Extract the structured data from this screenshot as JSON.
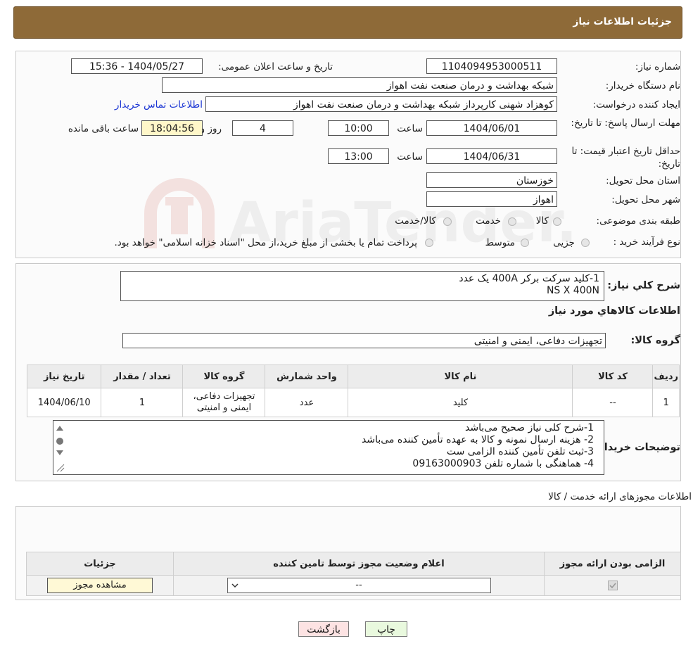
{
  "header": {
    "title": "جزئیات اطلاعات نیاز"
  },
  "form": {
    "need_number_label": "شماره نیاز:",
    "need_number": "1104094953000511",
    "announce_label": "تاریخ و ساعت اعلان عمومی:",
    "announce_value": "1404/05/27 - 15:36",
    "buyer_org_label": "نام دستگاه خریدار:",
    "buyer_org": "شبکه بهداشت و درمان صنعت نفت اهواز",
    "requester_label": "ایجاد کننده درخواست:",
    "requester": "کوهزاد شهنی کارپرداز شبکه بهداشت و درمان صنعت نفت اهواز",
    "contact_link": "اطلاعات تماس خریدار",
    "deadline_label": "مهلت ارسال پاسخ: تا تاریخ:",
    "deadline_date": "1404/06/01",
    "time_label": "ساعت",
    "deadline_time": "10:00",
    "days_value": "4",
    "days_label": "روز و",
    "remaining_time": "18:04:56",
    "remaining_label": "ساعت باقی مانده",
    "price_validity_label": "حداقل تاریخ اعتبار قیمت: تا تاریخ:",
    "price_validity_date": "1404/06/31",
    "price_validity_time": "13:00",
    "province_label": "استان محل تحویل:",
    "province": "خوزستان",
    "city_label": "شهر محل تحویل:",
    "city": "اهواز",
    "category_label": "طبقه بندی موضوعی:",
    "category_options": [
      "کالا",
      "خدمت",
      "کالا/خدمت"
    ],
    "process_label": "نوع فرآیند خرید :",
    "process_options": [
      "جزیی",
      "متوسط"
    ],
    "process_note": "پرداخت تمام یا بخشی از مبلغ خرید،از محل \"اسناد خزانه اسلامی\" خواهد بود."
  },
  "description": {
    "label": "شرح کلي نياز:",
    "lines": [
      "1-کلید سرکت برکر 400A یک عدد",
      "NS X 400N"
    ]
  },
  "goods": {
    "section_title": "اطلاعات کالاهاي مورد نياز",
    "group_label": "گروه کالا:",
    "group_value": "تجهیزات دفاعی، ایمنی و امنیتی",
    "columns": [
      "رديف",
      "کد کالا",
      "نام کالا",
      "واحد شمارش",
      "گروه کالا",
      "تعداد / مقدار",
      "تاریخ نیاز"
    ],
    "rows": [
      {
        "row": "1",
        "code": "--",
        "name": "کلید",
        "unit": "عدد",
        "group": "تجهیزات دفاعی، ایمنی و امنیتی",
        "qty": "1",
        "date": "1404/06/10"
      }
    ]
  },
  "buyer_notes": {
    "label": "توضیحات خریدار:",
    "lines": [
      "1-شرح کلی نیاز صحیح می‌باشد",
      "2- هزینه ارسال نمونه و کالا به عهده تأمین کننده می‌باشد",
      "3-ثبت تلفن تأمین کننده الزامی ست",
      "4- هماهنگی با شماره تلفن 09163000903"
    ]
  },
  "permits": {
    "section_title": "اطلاعات مجوزهای ارائه خدمت / کالا",
    "columns": [
      "الزامی بودن ارائه مجوز",
      "اعلام وضعیت مجوز توسط تامین کننده",
      "جزئیات"
    ],
    "select_value": "--",
    "view_button": "مشاهده مجوز"
  },
  "actions": {
    "print": "چاپ",
    "back": "بازگشت"
  },
  "watermark": {
    "text": "AriaTender.neT"
  }
}
